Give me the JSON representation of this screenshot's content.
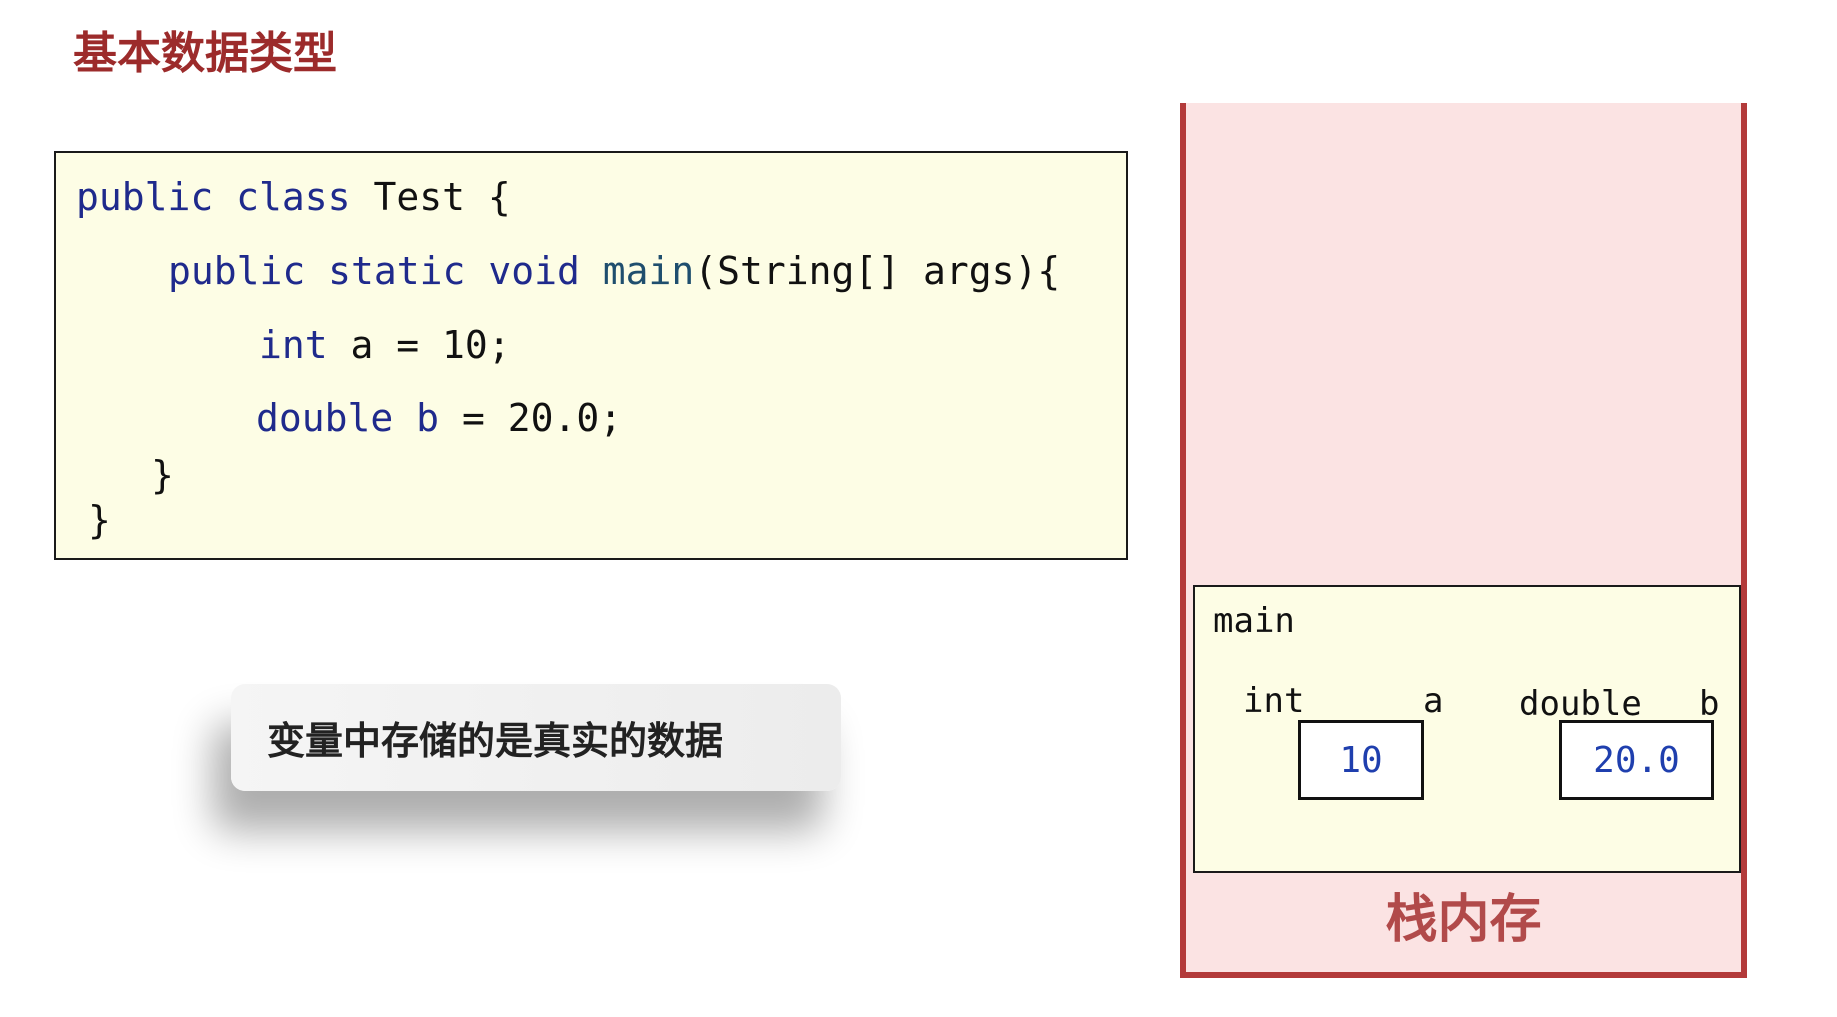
{
  "title": "基本数据类型",
  "code": {
    "line1": {
      "kw1": "public",
      "kw2": "class",
      "rest": "Test {"
    },
    "line2": {
      "kw1": "public",
      "kw2": "static",
      "kw3": "void",
      "fn": "main",
      "rest": "(String[] args){"
    },
    "line3": {
      "kw": "int",
      "rest": "a = 10;"
    },
    "line4": {
      "kw": "double",
      "rest1": "b",
      "rest2": "= 20.0;"
    },
    "line5": "}",
    "line6": "}"
  },
  "callout": {
    "text": "变量中存储的是真实的数据"
  },
  "stack": {
    "label": "栈内存",
    "frame": {
      "name": "main",
      "vars": [
        {
          "type": "int",
          "name": "a",
          "value": "10"
        },
        {
          "type": "double",
          "name": "b",
          "value": "20.0"
        }
      ]
    }
  },
  "colors": {
    "title": "#9c2b2b",
    "keyword": "#1f2a8c",
    "value": "#1f3fae",
    "stack_wall": "#b33a3a",
    "stack_fill": "#fbe3e3",
    "code_bg": "#fdfde5"
  }
}
